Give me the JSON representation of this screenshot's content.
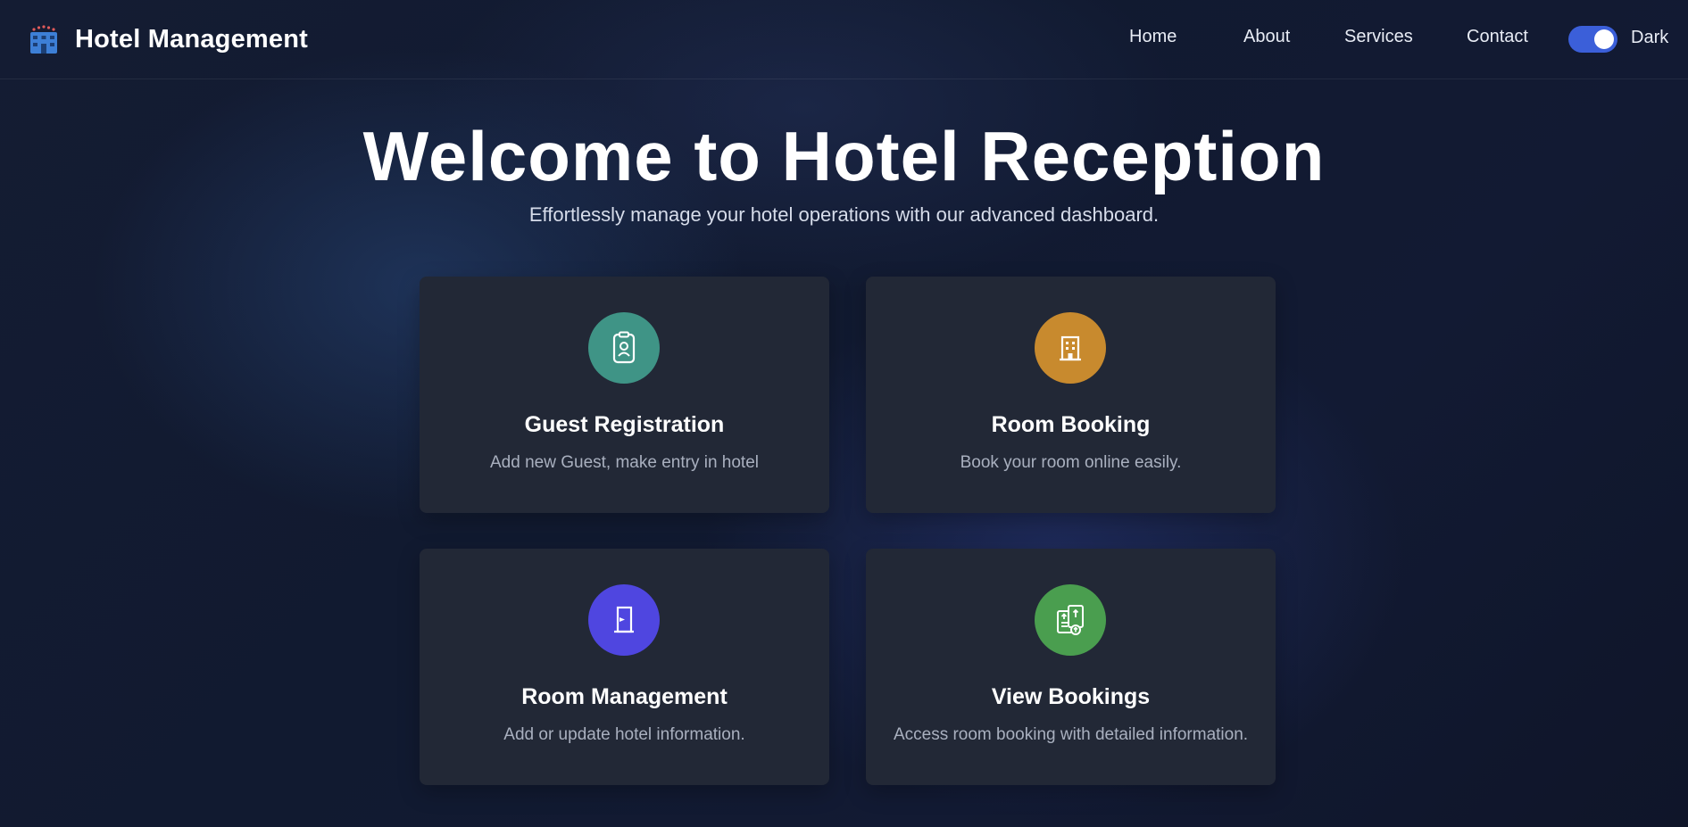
{
  "app": {
    "title": "Hotel Management",
    "logo_icon": "hotel-building-icon"
  },
  "nav": {
    "links": [
      "Home",
      "About",
      "Services",
      "Contact"
    ]
  },
  "theme_toggle": {
    "label": "Dark",
    "enabled": true,
    "color": "#3b5fd9"
  },
  "hero": {
    "title": "Welcome to Hotel Reception",
    "subtitle": "Effortlessly manage your hotel operations with our advanced dashboard."
  },
  "cards": [
    {
      "title": "Guest Registration",
      "description": "Add new Guest, make entry in hotel",
      "icon": "id-badge-icon",
      "color": "#3f9486"
    },
    {
      "title": "Room Booking",
      "description": "Book your room online easily.",
      "icon": "building-icon",
      "color": "#c88a2e"
    },
    {
      "title": "Room Management",
      "description": "Add or update hotel information.",
      "icon": "door-icon",
      "color": "#4f46e0"
    },
    {
      "title": "View Bookings",
      "description": "Access room booking with detailed information.",
      "icon": "documents-icon",
      "color": "#4a9e4f"
    }
  ]
}
